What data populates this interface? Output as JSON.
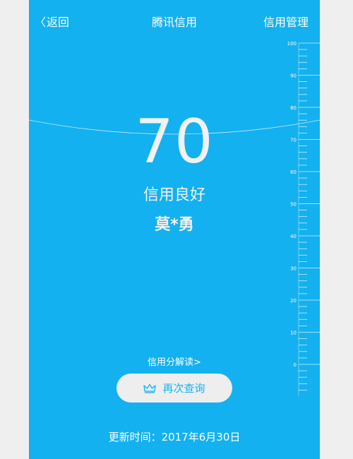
{
  "nav": {
    "back_label": "返回",
    "title": "腾讯信用",
    "manage_label": "信用管理"
  },
  "credit": {
    "score": "70",
    "level": "信用良好",
    "name": "莫*勇"
  },
  "ruler": {
    "labels": [
      "100",
      "90",
      "80",
      "70",
      "60",
      "50",
      "40",
      "30",
      "20",
      "10",
      "0"
    ]
  },
  "actions": {
    "explain_label": "信用分解读>",
    "requery_label": "再次查询"
  },
  "footer": {
    "update_prefix": "更新时间：",
    "update_date": "2017年6月30日"
  },
  "colors": {
    "background": "#13b1ef",
    "page": "#efefef",
    "button_bg": "#eeeeee",
    "button_text": "#13b1ef"
  },
  "icons": {
    "requery": "crown-icon",
    "back": "chevron-left-icon"
  }
}
